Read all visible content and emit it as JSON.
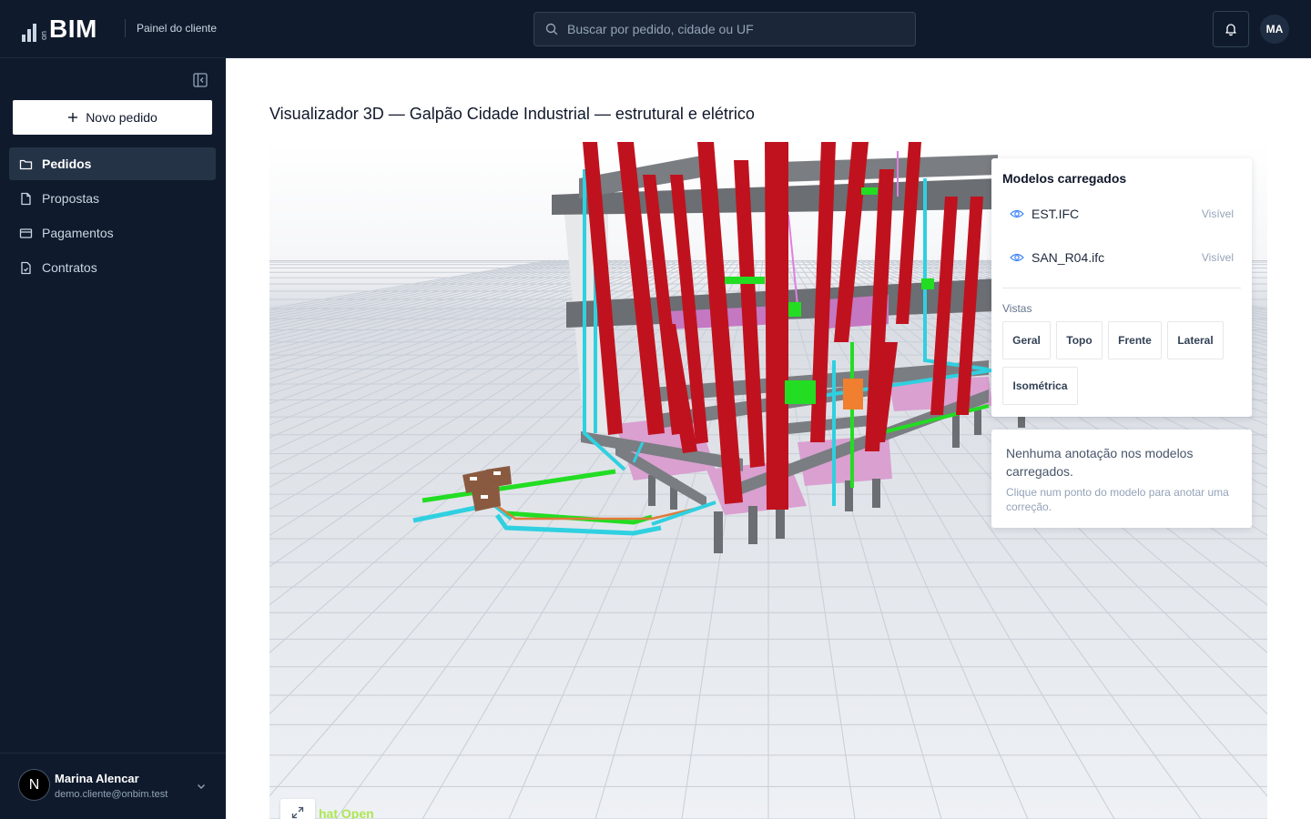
{
  "app": {
    "logo_text": "BIM",
    "logo_prefix": "on",
    "subtitle": "Painel do cliente"
  },
  "search": {
    "placeholder": "Buscar por pedido, cidade ou UF",
    "value": ""
  },
  "header": {
    "avatar_initials": "MA",
    "bell_icon": "bell-icon"
  },
  "sidebar": {
    "new_order_label": "Novo pedido",
    "items": [
      {
        "label": "Pedidos",
        "icon": "folder-icon",
        "active": true
      },
      {
        "label": "Propostas",
        "icon": "document-icon",
        "active": false
      },
      {
        "label": "Pagamentos",
        "icon": "card-icon",
        "active": false
      },
      {
        "label": "Contratos",
        "icon": "contract-icon",
        "active": false
      }
    ]
  },
  "user": {
    "initial": "N",
    "name": "Marina Alencar",
    "email": "demo.cliente@onbim.test"
  },
  "main": {
    "title": "Visualizador 3D — Galpão Cidade Industrial — estrutural e elétrico"
  },
  "viewer": {
    "watermark": "hat Open",
    "models_panel": {
      "title": "Modelos carregados",
      "models": [
        {
          "name": "EST.IFC",
          "status": "Visível"
        },
        {
          "name": "SAN_R04.ifc",
          "status": "Visível"
        }
      ],
      "views_label": "Vistas",
      "views": [
        "Geral",
        "Topo",
        "Frente",
        "Lateral",
        "Isométrica"
      ]
    },
    "notes_panel": {
      "message": "Nenhuma anotação nos modelos carregados.",
      "hint": "Clique num ponto do modelo para anotar uma correção."
    }
  },
  "colors": {
    "nav_bg": "#0f1b2d",
    "active_item_bg": "#253347",
    "column_red": "#c0121e",
    "beam_gray": "#6b6e72",
    "pipe_cyan": "#2fd0e0",
    "pipe_green": "#22dd22",
    "pipe_orange": "#e07a3a",
    "footing_pink": "#d9a0d0"
  }
}
